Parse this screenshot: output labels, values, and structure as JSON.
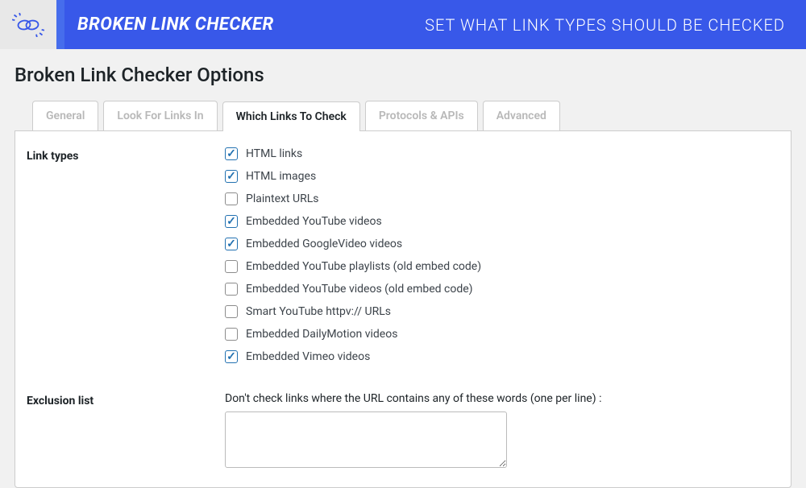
{
  "header": {
    "app_title": "BROKEN LINK CHECKER",
    "subtitle": "SET WHAT LINK TYPES SHOULD BE CHECKED"
  },
  "page_title": "Broken Link Checker Options",
  "tabs": [
    {
      "label": "General",
      "active": false
    },
    {
      "label": "Look For Links In",
      "active": false
    },
    {
      "label": "Which Links To Check",
      "active": true
    },
    {
      "label": "Protocols & APIs",
      "active": false
    },
    {
      "label": "Advanced",
      "active": false
    }
  ],
  "sections": {
    "link_types": {
      "label": "Link types",
      "items": [
        {
          "label": "HTML links",
          "checked": true
        },
        {
          "label": "HTML images",
          "checked": true
        },
        {
          "label": "Plaintext URLs",
          "checked": false
        },
        {
          "label": "Embedded YouTube videos",
          "checked": true
        },
        {
          "label": "Embedded GoogleVideo videos",
          "checked": true
        },
        {
          "label": "Embedded YouTube playlists (old embed code)",
          "checked": false
        },
        {
          "label": "Embedded YouTube videos (old embed code)",
          "checked": false
        },
        {
          "label": "Smart YouTube httpv:// URLs",
          "checked": false
        },
        {
          "label": "Embedded DailyMotion videos",
          "checked": false
        },
        {
          "label": "Embedded Vimeo videos",
          "checked": true
        }
      ]
    },
    "exclusion": {
      "label": "Exclusion list",
      "description": "Don't check links where the URL contains any of these words (one per line) :",
      "value": ""
    }
  }
}
